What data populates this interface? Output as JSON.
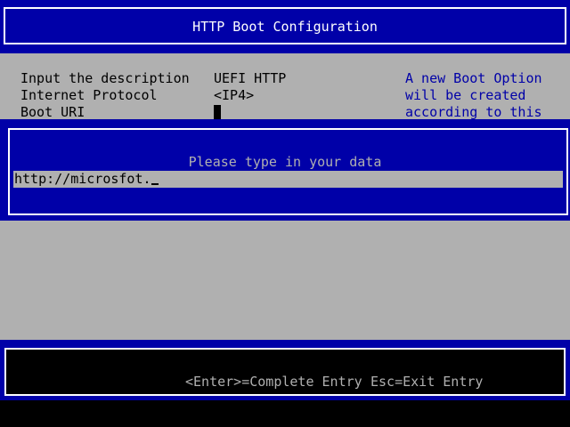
{
  "header": {
    "title": "HTTP Boot Configuration"
  },
  "form": {
    "rows": [
      {
        "label": "Input the description",
        "value": "UEFI HTTP"
      },
      {
        "label": "Internet Protocol",
        "value": "<IP4>"
      },
      {
        "label": "Boot URI",
        "value": ""
      }
    ],
    "help_lines": [
      "A new Boot Option",
      "will be created",
      "according to this"
    ]
  },
  "dialog": {
    "prompt": "Please type in your data",
    "input_value": "http://microsfot."
  },
  "footer": {
    "enter_hint": "<Enter>=Complete Entry",
    "esc_hint": "Esc=Exit Entry"
  },
  "colors": {
    "background": "#b0b0b0",
    "bios_blue": "#0000a8",
    "text_white": "#ffffff",
    "text_black": "#000000"
  }
}
